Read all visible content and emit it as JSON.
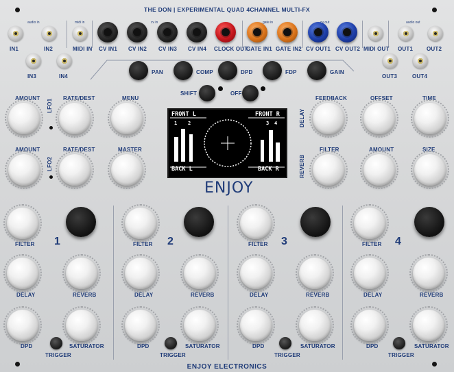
{
  "header": {
    "title": "THE DON | EXPERIMENTAL QUAD 4CHANNEL MULTI-FX"
  },
  "footer": {
    "brand": "ENJOY ELECTRONICS"
  },
  "logo": {
    "text": "ENJOY"
  },
  "top_sections": {
    "audio_in": "audio in",
    "midi_in": "midi in",
    "cv_in": "cv in",
    "gate_in": "gate in",
    "cv_out": "cv out",
    "audio_out": "audio out"
  },
  "jacks": {
    "in1": "IN1",
    "in2": "IN2",
    "in3": "IN3",
    "in4": "IN4",
    "midi_in": "MIDI IN",
    "cv_in1": "CV IN1",
    "cv_in2": "CV IN2",
    "cv_in3": "CV IN3",
    "cv_in4": "CV IN4",
    "clock_out": "CLOCK OUT",
    "gate_in1": "GATE IN1",
    "gate_in2": "GATE IN2",
    "cv_out1": "CV OUT1",
    "cv_out2": "CV OUT2",
    "midi_out": "MIDI OUT",
    "out1": "OUT1",
    "out2": "OUT2",
    "out3": "OUT3",
    "out4": "OUT4"
  },
  "jack_colors": {
    "grey": "#c8c8c8",
    "black": "#1a1a1a",
    "red": "#c4161c",
    "orange": "#d9731a",
    "blue": "#1d3ea8"
  },
  "buttons": {
    "pan": "PAN",
    "comp": "COMP",
    "dpd": "DPD",
    "fdp": "FDP",
    "gain": "GAIN",
    "shift": "SHIFT",
    "off": "OFF"
  },
  "lfo": {
    "amount1": "AMOUNT",
    "rate1": "RATE/DEST",
    "lfo1": "LFO1",
    "amount2": "AMOUNT",
    "rate2": "RATE/DEST",
    "lfo2": "LFO2",
    "menu": "MENU",
    "master": "MASTER"
  },
  "delay": {
    "section": "DELAY",
    "feedback": "FEEDBACK",
    "offset": "OFFSET",
    "time": "TIME"
  },
  "reverb": {
    "section": "REVERB",
    "filter": "FILTER",
    "amount": "AMOUNT",
    "size": "SIZE"
  },
  "screen": {
    "front_l": "FRONT L",
    "front_r": "FRONT R",
    "back_l": "BACK L",
    "back_r": "BACK R",
    "n1": "1",
    "n2": "2",
    "n3": "3",
    "n4": "4"
  },
  "channels": [
    {
      "num": "1",
      "filter": "FILTER",
      "delay": "DELAY",
      "reverb": "REVERB",
      "dpd": "DPD",
      "trigger": "TRIGGER",
      "saturator": "SATURATOR"
    },
    {
      "num": "2",
      "filter": "FILTER",
      "delay": "DELAY",
      "reverb": "REVERB",
      "dpd": "DPD",
      "trigger": "TRIGGER",
      "saturator": "SATURATOR"
    },
    {
      "num": "3",
      "filter": "FILTER",
      "delay": "DELAY",
      "reverb": "REVERB",
      "dpd": "DPD",
      "trigger": "TRIGGER",
      "saturator": "SATURATOR"
    },
    {
      "num": "4",
      "filter": "FILTER",
      "delay": "DELAY",
      "reverb": "REVERB",
      "dpd": "DPD",
      "trigger": "TRIGGER",
      "saturator": "SATURATOR"
    }
  ]
}
